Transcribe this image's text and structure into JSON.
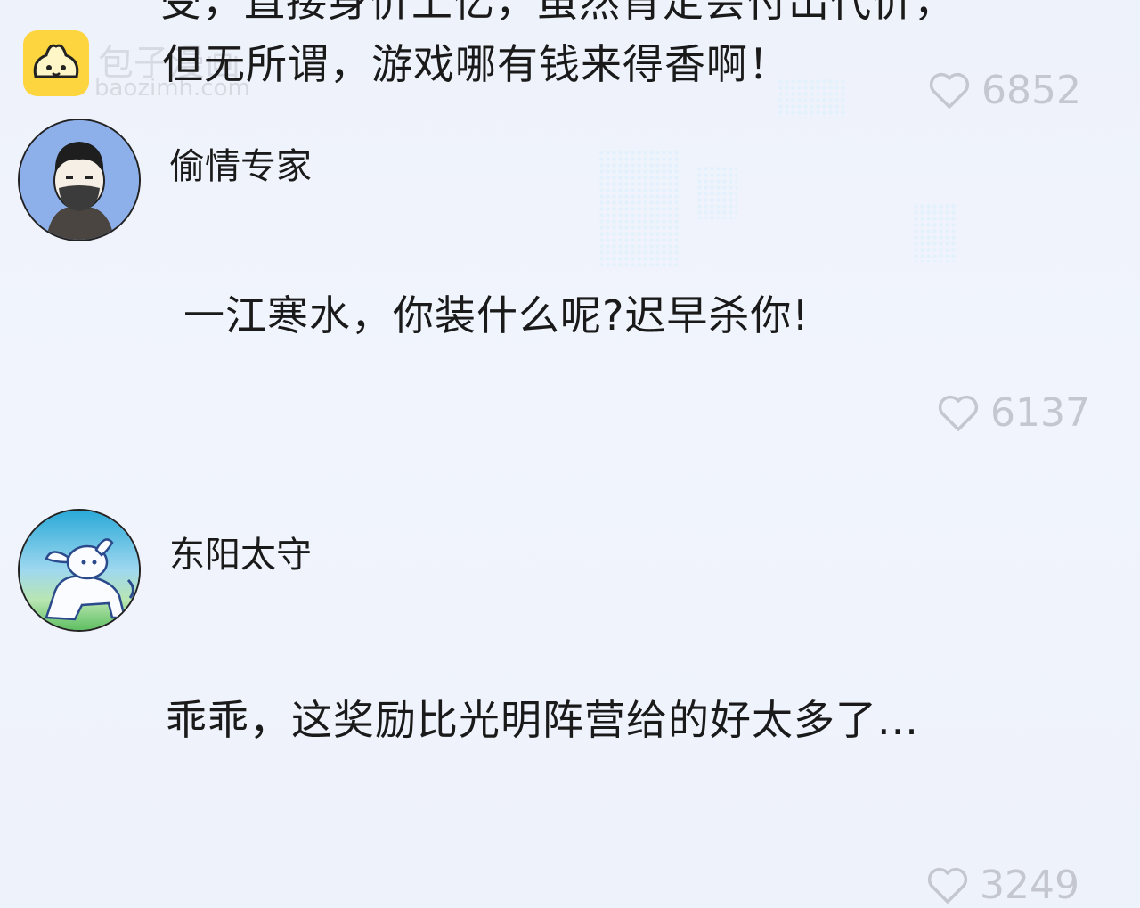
{
  "watermark": {
    "name": "包子漫画",
    "url": "baozimh.com"
  },
  "comments": [
    {
      "text_top": "受，直接身价上亿，虽然肯定会付出代价，",
      "text": "但无所谓，游戏哪有钱来得香啊！",
      "likes": "6852"
    },
    {
      "user": "偷情专家",
      "text": "一江寒水，你装什么呢?迟早杀你!",
      "likes": "6137"
    },
    {
      "user": "东阳太守",
      "text": "乖乖，这奖励比光明阵营给的好太多了...",
      "likes": "3249"
    }
  ]
}
